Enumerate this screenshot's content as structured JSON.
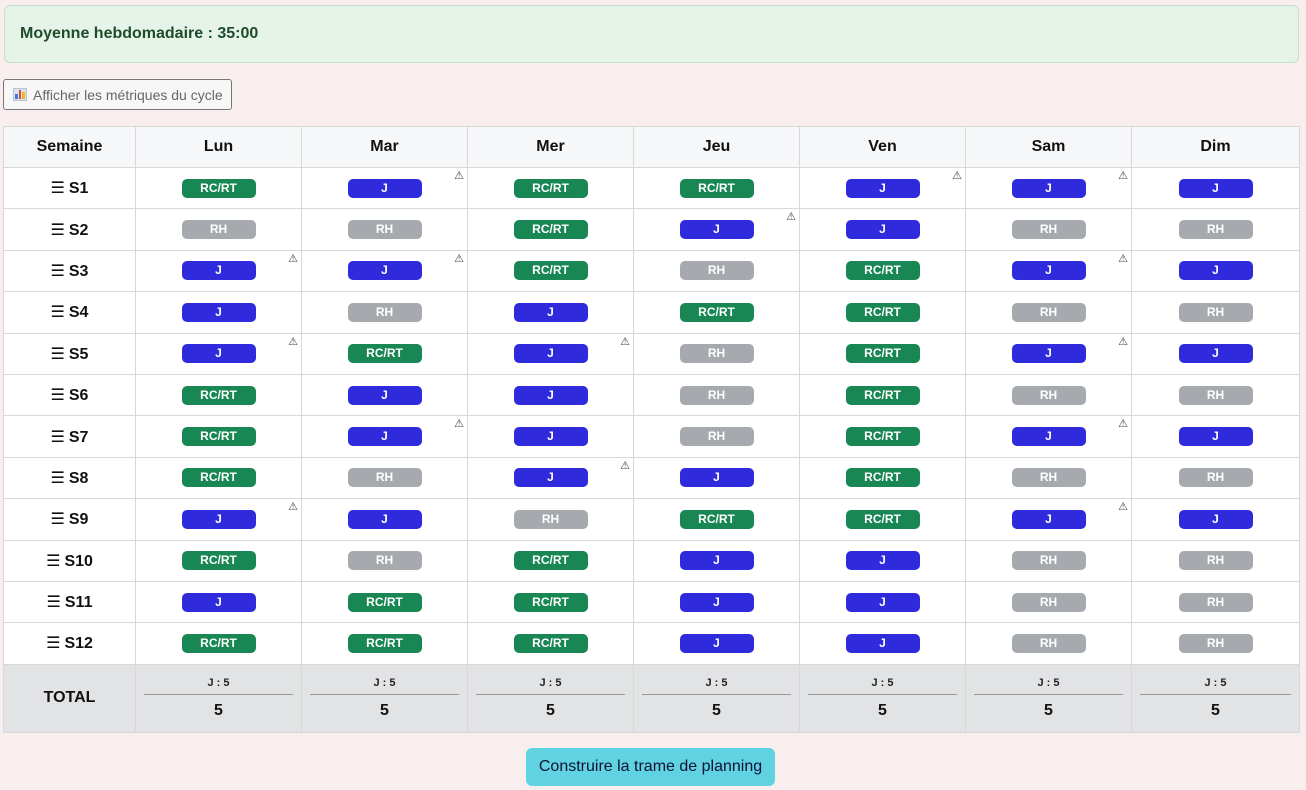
{
  "summary": {
    "text": "Moyenne hebdomadaire : 35:00"
  },
  "metrics_button": {
    "label": "Afficher les métriques du cycle",
    "icon": "bar-chart-icon"
  },
  "colors": {
    "J": "#2f2adb",
    "RC/RT": "#198754",
    "RH": "#a6a9ad"
  },
  "warning_icon": "⚠",
  "drag_icon": "☰",
  "table": {
    "corner": "Semaine",
    "days": [
      "Lun",
      "Mar",
      "Mer",
      "Jeu",
      "Ven",
      "Sam",
      "Dim"
    ],
    "rows": [
      {
        "week": "S1",
        "cells": [
          {
            "v": "RC/RT",
            "w": false
          },
          {
            "v": "J",
            "w": true
          },
          {
            "v": "RC/RT",
            "w": false
          },
          {
            "v": "RC/RT",
            "w": false
          },
          {
            "v": "J",
            "w": true
          },
          {
            "v": "J",
            "w": true
          },
          {
            "v": "J",
            "w": false
          }
        ]
      },
      {
        "week": "S2",
        "cells": [
          {
            "v": "RH",
            "w": false
          },
          {
            "v": "RH",
            "w": false
          },
          {
            "v": "RC/RT",
            "w": false
          },
          {
            "v": "J",
            "w": true
          },
          {
            "v": "J",
            "w": false
          },
          {
            "v": "RH",
            "w": false
          },
          {
            "v": "RH",
            "w": false
          }
        ]
      },
      {
        "week": "S3",
        "cells": [
          {
            "v": "J",
            "w": true
          },
          {
            "v": "J",
            "w": true
          },
          {
            "v": "RC/RT",
            "w": false
          },
          {
            "v": "RH",
            "w": false
          },
          {
            "v": "RC/RT",
            "w": false
          },
          {
            "v": "J",
            "w": true
          },
          {
            "v": "J",
            "w": false
          }
        ]
      },
      {
        "week": "S4",
        "cells": [
          {
            "v": "J",
            "w": false
          },
          {
            "v": "RH",
            "w": false
          },
          {
            "v": "J",
            "w": false
          },
          {
            "v": "RC/RT",
            "w": false
          },
          {
            "v": "RC/RT",
            "w": false
          },
          {
            "v": "RH",
            "w": false
          },
          {
            "v": "RH",
            "w": false
          }
        ]
      },
      {
        "week": "S5",
        "cells": [
          {
            "v": "J",
            "w": true
          },
          {
            "v": "RC/RT",
            "w": false
          },
          {
            "v": "J",
            "w": true
          },
          {
            "v": "RH",
            "w": false
          },
          {
            "v": "RC/RT",
            "w": false
          },
          {
            "v": "J",
            "w": true
          },
          {
            "v": "J",
            "w": false
          }
        ]
      },
      {
        "week": "S6",
        "cells": [
          {
            "v": "RC/RT",
            "w": false
          },
          {
            "v": "J",
            "w": false
          },
          {
            "v": "J",
            "w": false
          },
          {
            "v": "RH",
            "w": false
          },
          {
            "v": "RC/RT",
            "w": false
          },
          {
            "v": "RH",
            "w": false
          },
          {
            "v": "RH",
            "w": false
          }
        ]
      },
      {
        "week": "S7",
        "cells": [
          {
            "v": "RC/RT",
            "w": false
          },
          {
            "v": "J",
            "w": true
          },
          {
            "v": "J",
            "w": false
          },
          {
            "v": "RH",
            "w": false
          },
          {
            "v": "RC/RT",
            "w": false
          },
          {
            "v": "J",
            "w": true
          },
          {
            "v": "J",
            "w": false
          }
        ]
      },
      {
        "week": "S8",
        "cells": [
          {
            "v": "RC/RT",
            "w": false
          },
          {
            "v": "RH",
            "w": false
          },
          {
            "v": "J",
            "w": true
          },
          {
            "v": "J",
            "w": false
          },
          {
            "v": "RC/RT",
            "w": false
          },
          {
            "v": "RH",
            "w": false
          },
          {
            "v": "RH",
            "w": false
          }
        ]
      },
      {
        "week": "S9",
        "cells": [
          {
            "v": "J",
            "w": true
          },
          {
            "v": "J",
            "w": false
          },
          {
            "v": "RH",
            "w": false
          },
          {
            "v": "RC/RT",
            "w": false
          },
          {
            "v": "RC/RT",
            "w": false
          },
          {
            "v": "J",
            "w": true
          },
          {
            "v": "J",
            "w": false
          }
        ]
      },
      {
        "week": "S10",
        "cells": [
          {
            "v": "RC/RT",
            "w": false
          },
          {
            "v": "RH",
            "w": false
          },
          {
            "v": "RC/RT",
            "w": false
          },
          {
            "v": "J",
            "w": false
          },
          {
            "v": "J",
            "w": false
          },
          {
            "v": "RH",
            "w": false
          },
          {
            "v": "RH",
            "w": false
          }
        ]
      },
      {
        "week": "S11",
        "cells": [
          {
            "v": "J",
            "w": false
          },
          {
            "v": "RC/RT",
            "w": false
          },
          {
            "v": "RC/RT",
            "w": false
          },
          {
            "v": "J",
            "w": false
          },
          {
            "v": "J",
            "w": false
          },
          {
            "v": "RH",
            "w": false
          },
          {
            "v": "RH",
            "w": false
          }
        ]
      },
      {
        "week": "S12",
        "cells": [
          {
            "v": "RC/RT",
            "w": false
          },
          {
            "v": "RC/RT",
            "w": false
          },
          {
            "v": "RC/RT",
            "w": false
          },
          {
            "v": "J",
            "w": false
          },
          {
            "v": "J",
            "w": false
          },
          {
            "v": "RH",
            "w": false
          },
          {
            "v": "RH",
            "w": false
          }
        ]
      }
    ],
    "totals": {
      "label": "TOTAL",
      "cells": [
        {
          "detail": "J : 5",
          "value": "5"
        },
        {
          "detail": "J : 5",
          "value": "5"
        },
        {
          "detail": "J : 5",
          "value": "5"
        },
        {
          "detail": "J : 5",
          "value": "5"
        },
        {
          "detail": "J : 5",
          "value": "5"
        },
        {
          "detail": "J : 5",
          "value": "5"
        },
        {
          "detail": "J : 5",
          "value": "5"
        }
      ]
    }
  },
  "build_button": {
    "label": "Construire la trame de planning"
  }
}
